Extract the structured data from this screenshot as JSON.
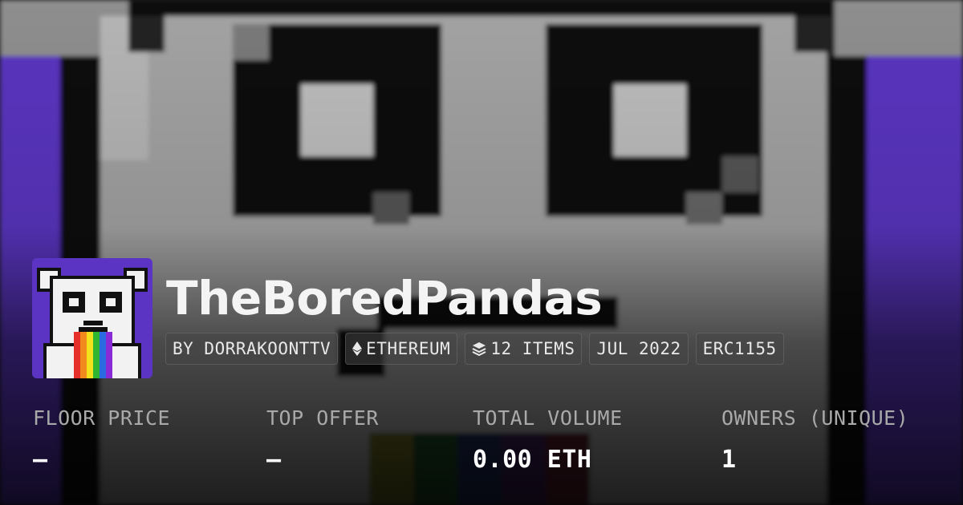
{
  "collection": {
    "name": "TheBoredPandas",
    "tags": [
      {
        "label": "BY DORRAKOONTTV",
        "icon": ""
      },
      {
        "label": "ETHEREUM",
        "icon": "ethereum-icon"
      },
      {
        "label": "12 ITEMS",
        "icon": "layers-icon"
      },
      {
        "label": "JUL 2022",
        "icon": ""
      },
      {
        "label": "ERC1155",
        "icon": ""
      }
    ]
  },
  "stats": [
    {
      "label": "FLOOR PRICE",
      "value": "–"
    },
    {
      "label": "TOP OFFER",
      "value": "–"
    },
    {
      "label": "TOTAL VOLUME",
      "value": "0.00 ETH"
    },
    {
      "label": "OWNERS (UNIQUE)",
      "value": "1"
    }
  ],
  "colors": {
    "background_purple": "#5b34c4",
    "panda_face_grey": "#a6a6a6",
    "stat_label": "#a9a9a9",
    "text_white": "#ffffff"
  }
}
